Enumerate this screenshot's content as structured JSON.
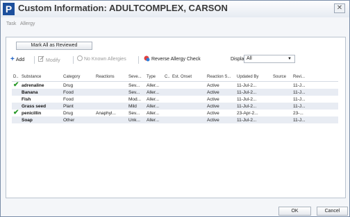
{
  "window": {
    "logo": "P",
    "title": "Custom Information: ADULTCOMPLEX, CARSON",
    "close": "✕"
  },
  "menu": [
    "Task",
    "Allergy"
  ],
  "mark_all_label": "Mark All as Reviewed",
  "toolbar": {
    "add": "Add",
    "modify": "Modify",
    "no_known": "No Known Allergies",
    "reverse_check": "Reverse Allergy Check",
    "display_label": "Display",
    "display_value": "All"
  },
  "columns": [
    "D..",
    "Substance",
    "Category",
    "Reactions",
    "Seve...",
    "Type",
    "C..",
    "Est. Onset",
    "Reaction S...",
    "Updated By",
    "Source",
    "Revi..."
  ],
  "rows": [
    {
      "check": "✔",
      "substance": "adrenaline",
      "category": "Drug",
      "reactions": "",
      "severity": "Sev...",
      "type": "Aller...",
      "c": "",
      "onset": "",
      "status": "Active",
      "updated": "11-Jul-2...",
      "source": "",
      "reviewed": "11-J..."
    },
    {
      "check": "",
      "substance": "Banana",
      "category": "Food",
      "reactions": "",
      "severity": "Sev...",
      "type": "Aller...",
      "c": "",
      "onset": "",
      "status": "Active",
      "updated": "11-Jul-2...",
      "source": "",
      "reviewed": "11-J..."
    },
    {
      "check": "",
      "substance": "Fish",
      "category": "Food",
      "reactions": "",
      "severity": "Mod...",
      "type": "Aller...",
      "c": "",
      "onset": "",
      "status": "Active",
      "updated": "11-Jul-2...",
      "source": "",
      "reviewed": "11-J..."
    },
    {
      "check": "",
      "substance": "Grass seed",
      "category": "Plant",
      "reactions": "",
      "severity": "Mild",
      "type": "Aller...",
      "c": "",
      "onset": "",
      "status": "Active",
      "updated": "11-Jul-2...",
      "source": "",
      "reviewed": "11-J..."
    },
    {
      "check": "✔",
      "substance": "penicillin",
      "category": "Drug",
      "reactions": "Anaphyl...",
      "severity": "Sev...",
      "type": "Aller...",
      "c": "",
      "onset": "",
      "status": "Active",
      "updated": "23-Apr-2...",
      "source": "",
      "reviewed": "23-..."
    },
    {
      "check": "",
      "substance": "Soap",
      "category": "Other",
      "reactions": "",
      "severity": "Unk...",
      "type": "Aller...",
      "c": "",
      "onset": "",
      "status": "Active",
      "updated": "11-Jul-2...",
      "source": "",
      "reviewed": "11-J..."
    }
  ],
  "buttons": {
    "ok": "OK",
    "cancel": "Cancel"
  },
  "colors": {
    "accent": "#1c4f9c",
    "check": "#2a9a2a",
    "alt_row": "#e8ecf3"
  }
}
